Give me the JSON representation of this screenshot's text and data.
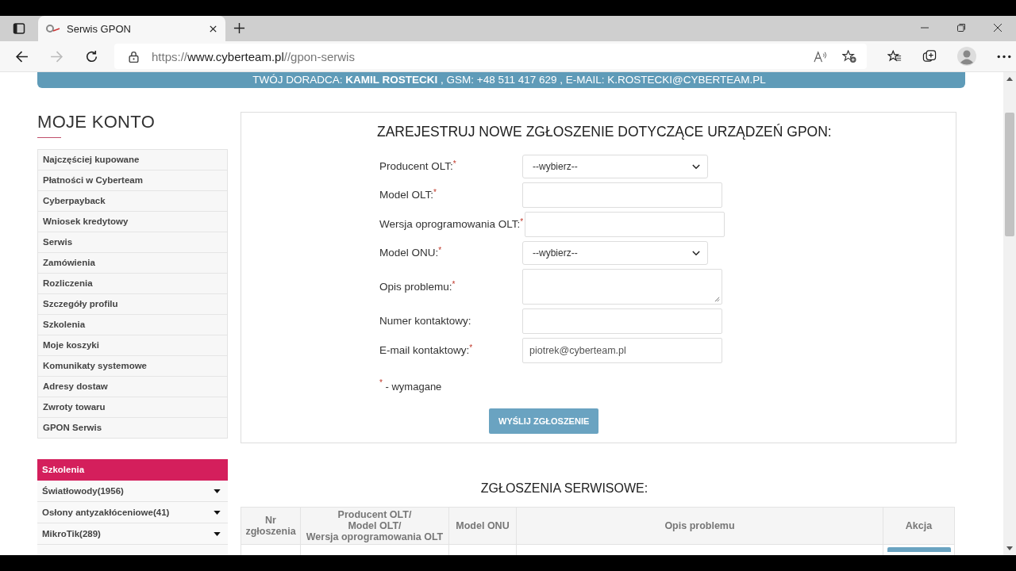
{
  "browser": {
    "tab_title": "Serwis GPON",
    "url_prefix": "https://",
    "url_host": "www.cyberteam.pl",
    "url_path": "//gpon-serwis",
    "forward_disabled": true
  },
  "banner": "TWÓJ DORADCA: **KAMIL ROSTECKI** , GSM: +48 511 417 629 , E-MAIL: K.ROSTECKI@CYBERTEAM.PL",
  "sidebar": {
    "title": "MOJE KONTO",
    "items": [
      {
        "label": "Najczęściej kupowane"
      },
      {
        "label": "Płatności w Cyberteam"
      },
      {
        "label": "Cyberpayback"
      },
      {
        "label": "Wniosek kredytowy"
      },
      {
        "label": "Serwis"
      },
      {
        "label": "Zamówienia"
      },
      {
        "label": "Rozliczenia"
      },
      {
        "label": "Szczegóły profilu"
      },
      {
        "label": "Szkolenia"
      },
      {
        "label": "Moje koszyki"
      },
      {
        "label": "Komunikaty systemowe"
      },
      {
        "label": "Adresy dostaw"
      },
      {
        "label": "Zwroty towaru"
      },
      {
        "label": "GPON Serwis"
      }
    ]
  },
  "categories": {
    "title": "Szkolenia",
    "items": [
      {
        "label": "Światłowody(1956)",
        "expanded": false
      },
      {
        "label": "Osłony antyzakłóceniowe(41)",
        "expanded": false
      },
      {
        "label": "MikroTik(289)",
        "expanded": false
      }
    ]
  },
  "form": {
    "title": "ZAREJESTRUJ NOWE ZGŁOSZENIE DOTYCZĄCE URZĄDZEŃ GPON:",
    "required_mark": "*",
    "fields": [
      {
        "label": "Producent OLT:",
        "kind": "select",
        "required": true,
        "value": "--wybierz--"
      },
      {
        "label": "Model OLT:",
        "kind": "input",
        "required": true
      },
      {
        "label": "Wersja oprogramowania OLT:",
        "kind": "input",
        "required": true
      },
      {
        "label": "Model ONU:",
        "kind": "select",
        "required": true,
        "value": "--wybierz--"
      },
      {
        "label": "Opis problemu:",
        "kind": "textarea",
        "required": true
      },
      {
        "label": "Numer kontaktowy:",
        "kind": "input",
        "required": false
      },
      {
        "label": "E-mail kontaktowy:",
        "kind": "input",
        "required": true,
        "value": "piotrek@cyberteam.pl"
      }
    ],
    "legend": "- wymagane",
    "submit": "WYŚLIJ ZGŁOSZENIE"
  },
  "requests": {
    "title": "ZGŁOSZENIA SERWISOWE:",
    "columns": [
      "Nr\nzgłoszenia",
      "Producent OLT/\nModel OLT/\nWersja oprogramowania OLT",
      "Model ONU",
      "Opis problemu",
      "Akcja"
    ]
  }
}
